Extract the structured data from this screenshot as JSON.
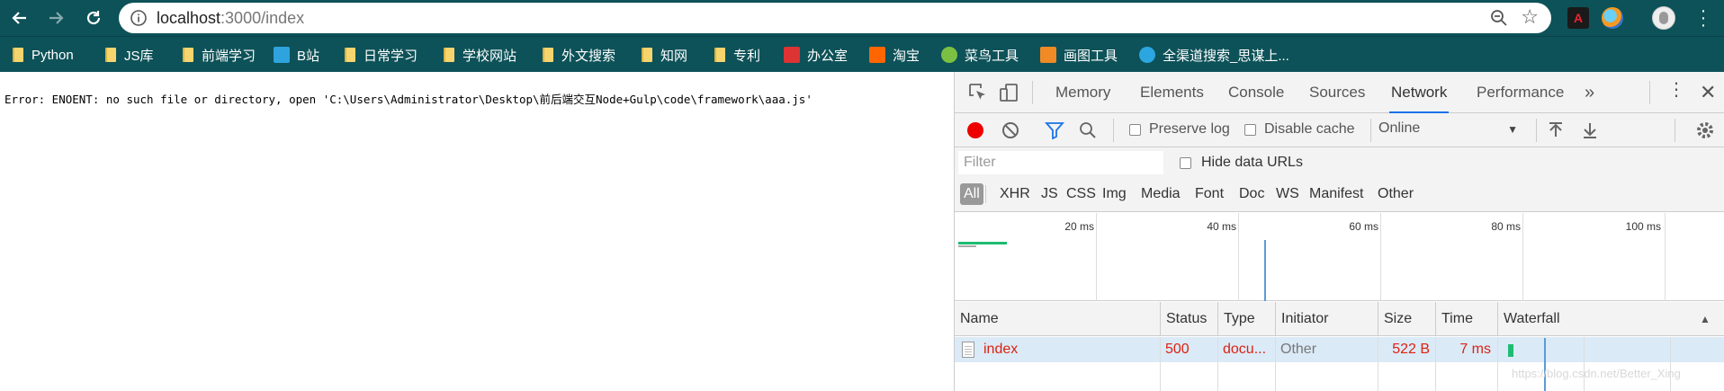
{
  "browser": {
    "url_host": "localhost",
    "url_path": ":3000/index",
    "ext_pdf_label": "A"
  },
  "bookmarks": [
    {
      "label": "Python",
      "icon": "folder-icon"
    },
    {
      "label": "JS库",
      "icon": "folder-icon"
    },
    {
      "label": "前端学习",
      "icon": "folder-icon"
    },
    {
      "label": "B站",
      "icon": "bilibili-icon"
    },
    {
      "label": "日常学习",
      "icon": "folder-icon"
    },
    {
      "label": "学校网站",
      "icon": "folder-icon"
    },
    {
      "label": "外文搜索",
      "icon": "folder-icon"
    },
    {
      "label": "知网",
      "icon": "folder-icon"
    },
    {
      "label": "专利",
      "icon": "folder-icon"
    },
    {
      "label": "办公室",
      "icon": "office-icon"
    },
    {
      "label": "淘宝",
      "icon": "taobao-icon"
    },
    {
      "label": "菜鸟工具",
      "icon": "runoob-icon"
    },
    {
      "label": "画图工具",
      "icon": "draw-icon"
    },
    {
      "label": "全渠道搜索_思谋上...",
      "icon": "globe-icon"
    }
  ],
  "page": {
    "error": "Error: ENOENT: no such file or directory, open 'C:\\Users\\Administrator\\Desktop\\前后端交互Node+Gulp\\code\\framework\\aaa.js'"
  },
  "devtools": {
    "tabs": [
      "Memory",
      "Elements",
      "Console",
      "Sources",
      "Network",
      "Performance"
    ],
    "active_tab": "Network",
    "more_label": "»",
    "preserve_log": "Preserve log",
    "disable_cache": "Disable cache",
    "throttle": "Online",
    "filter_placeholder": "Filter",
    "hide_data_urls": "Hide data URLs",
    "types": [
      "All",
      "XHR",
      "JS",
      "CSS",
      "Img",
      "Media",
      "Font",
      "Doc",
      "WS",
      "Manifest",
      "Other"
    ],
    "ticks": [
      "20 ms",
      "40 ms",
      "60 ms",
      "80 ms",
      "100 ms"
    ],
    "columns": [
      "Name",
      "Status",
      "Type",
      "Initiator",
      "Size",
      "Time",
      "Waterfall"
    ],
    "rows": [
      {
        "name": "index",
        "status": "500",
        "type": "docu...",
        "initiator": "Other",
        "size": "522 B",
        "time": "7 ms"
      }
    ]
  },
  "watermark": "https://blog.csdn.net/Better_Xing",
  "colors": {
    "toolbar": "#0d5258",
    "active_tab": "#1a73e8",
    "error_red": "#d21",
    "waterfall_green": "#1dbc72"
  }
}
